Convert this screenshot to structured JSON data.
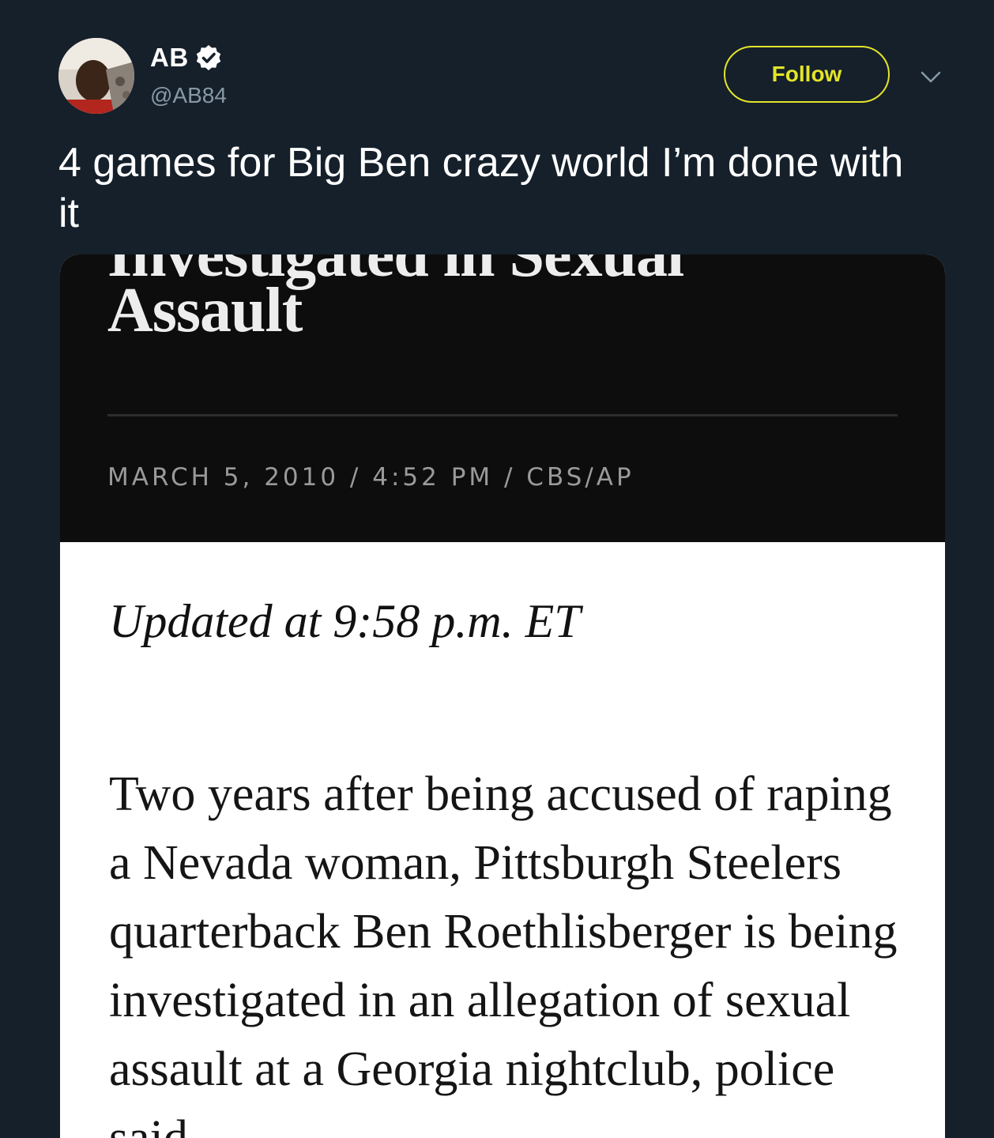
{
  "user": {
    "display_name": "AB",
    "handle": "@AB84",
    "verified": true,
    "avatar_icon": "user-avatar-photo"
  },
  "actions": {
    "follow_label": "Follow",
    "more_icon": "chevron-down-icon"
  },
  "tweet": {
    "text": "4 games for Big Ben crazy world I’m done with it"
  },
  "screenshot": {
    "headline_partial": "Investigated in Sexual",
    "headline_last": "Assault",
    "dateline": "MARCH 5, 2010 / 4:52 PM / CBS/AP",
    "updated": "Updated at 9:58 p.m. ET",
    "body": "Two years after being accused of raping a Nevada woman, Pittsburgh Steelers quarterback Ben Roethlisberger is being investigated in an allegation of sexual assault at a Georgia nightclub, police said."
  },
  "colors": {
    "background": "#15202b",
    "follow_accent": "#e4e42a",
    "secondary_text": "#8899a6"
  }
}
